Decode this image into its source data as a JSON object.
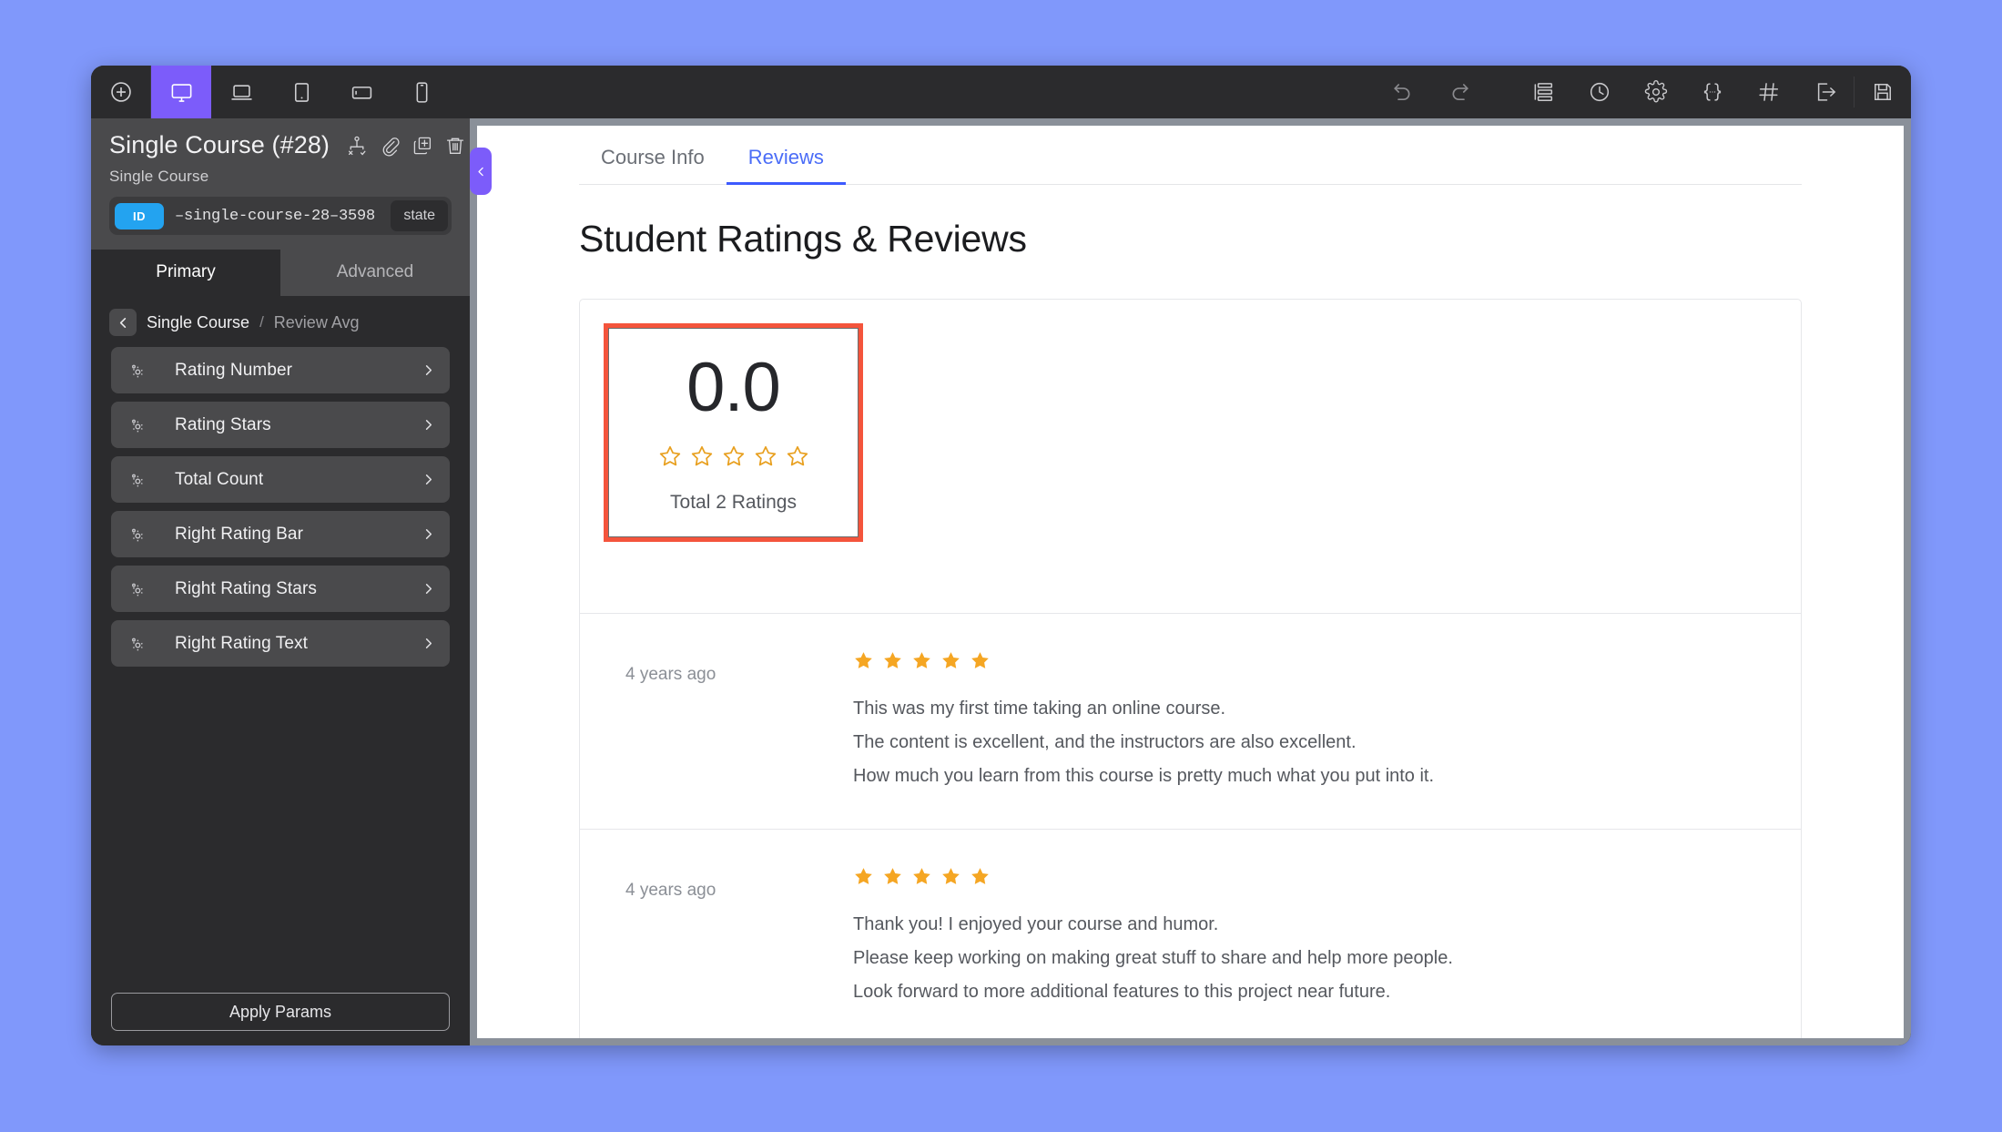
{
  "toolbar": {
    "left_icons": [
      {
        "name": "add-icon",
        "label": "Add"
      },
      {
        "name": "desktop-icon",
        "label": "Desktop"
      },
      {
        "name": "laptop-icon",
        "label": "Laptop"
      },
      {
        "name": "tablet-icon",
        "label": "Tablet"
      },
      {
        "name": "tablet-landscape-icon",
        "label": "Tablet Landscape"
      },
      {
        "name": "mobile-icon",
        "label": "Mobile"
      }
    ],
    "right_icons": [
      {
        "name": "undo-icon",
        "label": "Undo"
      },
      {
        "name": "redo-icon",
        "label": "Redo"
      },
      {
        "name": "layers-icon",
        "label": "Layers"
      },
      {
        "name": "history-icon",
        "label": "History"
      },
      {
        "name": "settings-gear-icon",
        "label": "Settings"
      },
      {
        "name": "code-braces-icon",
        "label": "Custom Code"
      },
      {
        "name": "grid-icon",
        "label": "Grid"
      },
      {
        "name": "export-icon",
        "label": "Export"
      },
      {
        "name": "save-icon",
        "label": "Save"
      }
    ]
  },
  "sidebar": {
    "title": "Single Course (#28)",
    "subtitle": "Single Course",
    "title_icons": [
      {
        "name": "condition-icon",
        "label": "Conditions"
      },
      {
        "name": "link-icon",
        "label": "Link"
      },
      {
        "name": "duplicate-icon",
        "label": "Duplicate"
      },
      {
        "name": "trash-icon",
        "label": "Delete"
      }
    ],
    "id_badge": "ID",
    "id_value": "–single-course-28–3598",
    "state_label": "state",
    "tabs": [
      {
        "label": "Primary",
        "active": true
      },
      {
        "label": "Advanced",
        "active": false
      }
    ],
    "breadcrumb": {
      "back_icon": "chevron-left-icon",
      "parent": "Single Course",
      "separator": "/",
      "current": "Review Avg"
    },
    "items": [
      {
        "label": "Rating Number"
      },
      {
        "label": "Rating Stars"
      },
      {
        "label": "Total Count"
      },
      {
        "label": "Right Rating Bar"
      },
      {
        "label": "Right Rating Stars"
      },
      {
        "label": "Right Rating Text"
      }
    ],
    "apply_label": "Apply Params"
  },
  "canvas": {
    "collapse_icon": "chevron-left-icon",
    "tabs": [
      {
        "label": "Course Info",
        "active": false
      },
      {
        "label": "Reviews",
        "active": true
      }
    ],
    "heading": "Student Ratings & Reviews",
    "summary": {
      "score": "0.0",
      "stars_filled": 0,
      "stars_total": 5,
      "total_text": "Total 2 Ratings",
      "selected": true,
      "selection_color": "#f4543c"
    },
    "reviews": [
      {
        "date": "4 years ago",
        "stars": 5,
        "lines": [
          "This was my first time taking an online course.",
          "The content is excellent, and the instructors are also excellent.",
          "How much you learn from this course is pretty much what you put into it."
        ]
      },
      {
        "date": "4 years ago",
        "stars": 5,
        "lines": [
          "Thank you! I enjoyed your course and humor.",
          "Please keep working on making great stuff to share and help more people.",
          "Look forward to more additional features to this project near future."
        ]
      }
    ]
  },
  "colors": {
    "accent_purple": "#7c5cfa",
    "page_background": "#8098fb",
    "star_orange": "#f5a623",
    "link_blue": "#4a6cf7",
    "selection_red": "#f4543c",
    "id_badge_blue": "#23a3f0"
  }
}
